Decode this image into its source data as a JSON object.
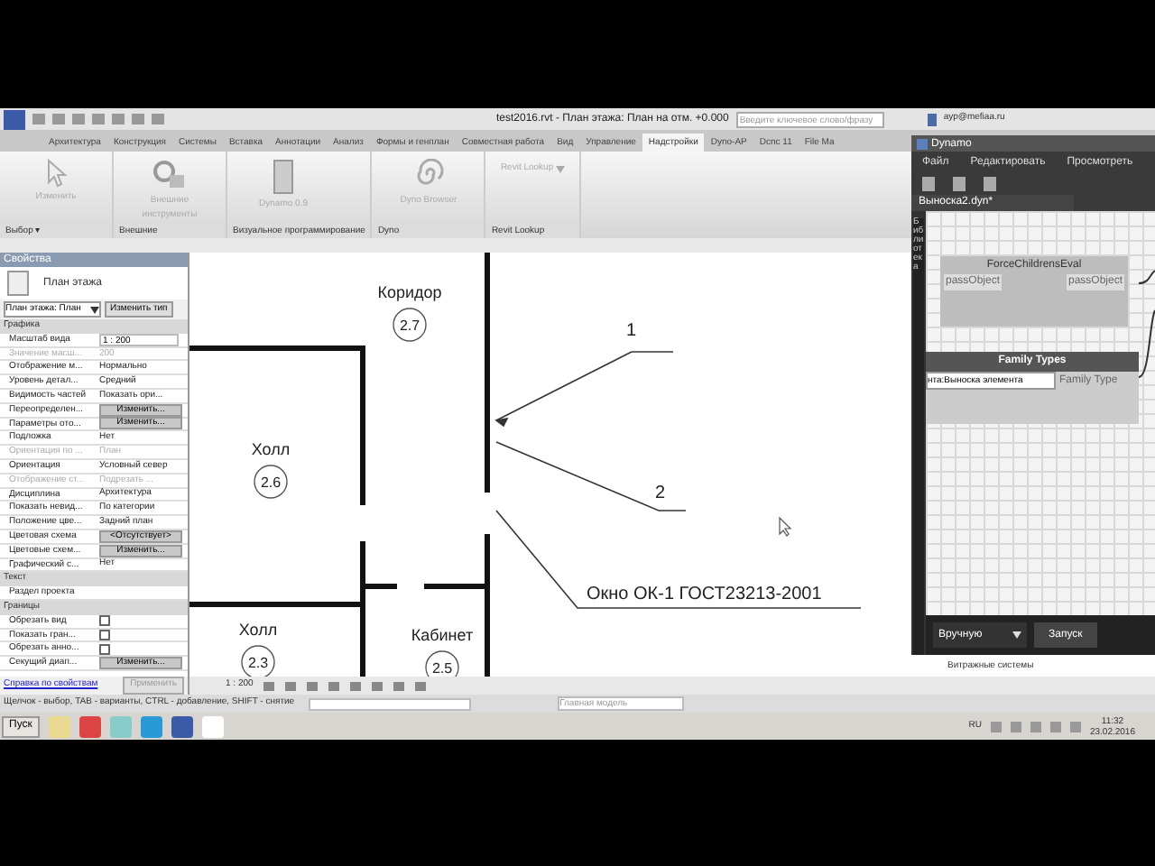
{
  "title_bar": {
    "title": "test2016.rvt - План этажа: План на отм. +0.000",
    "search": {
      "placeholder": "Введите ключевое слово/фразу"
    },
    "user": "ayp@mefiaa.ru"
  },
  "ribbon_tabs": [
    {
      "label": "Архитектура",
      "selected": false
    },
    {
      "label": "Конструкция",
      "selected": false
    },
    {
      "label": "Системы",
      "selected": false
    },
    {
      "label": "Вставка",
      "selected": false
    },
    {
      "label": "Аннотации",
      "selected": false
    },
    {
      "label": "Анализ",
      "selected": false
    },
    {
      "label": "Формы и генплан",
      "selected": false
    },
    {
      "label": "Совместная работа",
      "selected": false
    },
    {
      "label": "Вид",
      "selected": false
    },
    {
      "label": "Управление",
      "selected": false
    },
    {
      "label": "Надстройки",
      "selected": true
    },
    {
      "label": "Dyno-AP",
      "selected": false
    },
    {
      "label": "Dcnc 11",
      "selected": false
    },
    {
      "label": "File Ma",
      "selected": false
    }
  ],
  "ribbon_panels": [
    {
      "label": "Выбор ▾",
      "buttons": [
        {
          "label": "Изменить",
          "kind": "cursor"
        }
      ]
    },
    {
      "label": "Внешние",
      "buttons": [
        {
          "label": "Внешние инструменты",
          "kind": "tools"
        }
      ]
    },
    {
      "label": "Визуальное программирование",
      "buttons": [
        {
          "label": "Dynamo 0.9",
          "kind": "dynamo"
        }
      ]
    },
    {
      "label": "Dyno",
      "buttons": [
        {
          "label": "Dyno Browser",
          "kind": "spiral"
        }
      ]
    },
    {
      "label": "Revit Lookup",
      "buttons": [
        {
          "label": "Revit Lookup",
          "kind": "dropdown"
        }
      ]
    }
  ],
  "properties": {
    "title": "Свойства",
    "type_name": "План этажа",
    "type_select": "План этажа: План",
    "edit_type": "Изменить тип",
    "sections": [
      {
        "title": "Графика",
        "rows": [
          {
            "label": "Масштаб вида",
            "value": "1 : 200",
            "kind": "input",
            "disabled": false
          },
          {
            "label": "Значение масш...",
            "value": "200",
            "kind": "text",
            "disabled": true
          },
          {
            "label": "Отображение м...",
            "value": "Нормально",
            "kind": "text",
            "disabled": false
          },
          {
            "label": "Уровень детал...",
            "value": "Средний",
            "kind": "text",
            "disabled": false
          },
          {
            "label": "Видимость частей",
            "value": "Показать ори...",
            "kind": "text",
            "disabled": false
          },
          {
            "label": "Переопределен...",
            "value": "Изменить...",
            "kind": "button",
            "disabled": false
          },
          {
            "label": "Параметры ото...",
            "value": "Изменить...",
            "kind": "button",
            "disabled": false
          },
          {
            "label": "Подложка",
            "value": "Нет",
            "kind": "text",
            "disabled": false
          },
          {
            "label": "Ориентация по ...",
            "value": "План",
            "kind": "text",
            "disabled": true
          },
          {
            "label": "Ориентация",
            "value": "Условный север",
            "kind": "text",
            "disabled": false
          },
          {
            "label": "Отображение ст...",
            "value": "Подрезать ...",
            "kind": "text",
            "disabled": true
          },
          {
            "label": "Дисциплина",
            "value": "Архитектура",
            "kind": "text",
            "disabled": false
          },
          {
            "label": "Показать невид...",
            "value": "По категории",
            "kind": "text",
            "disabled": false
          },
          {
            "label": "Положение цве...",
            "value": "Задний план",
            "kind": "text",
            "disabled": false
          },
          {
            "label": "Цветовая схема",
            "value": "<Отсутствует>",
            "kind": "button",
            "disabled": false
          },
          {
            "label": "Цветовые схем...",
            "value": "Изменить...",
            "kind": "button",
            "disabled": false
          },
          {
            "label": "Графический с...",
            "value": "Нет",
            "kind": "text",
            "disabled": false
          }
        ]
      },
      {
        "title": "Текст",
        "rows": [
          {
            "label": "Раздел проекта",
            "kind": "text",
            "disabled": false
          }
        ]
      },
      {
        "title": "Границы",
        "rows": [
          {
            "label": "Обрезать вид",
            "kind": "check",
            "checked": false,
            "disabled": false
          },
          {
            "label": "Показать гран...",
            "kind": "check",
            "checked": false,
            "disabled": false
          },
          {
            "label": "Обрезать анно...",
            "kind": "check",
            "checked": false,
            "disabled": false
          },
          {
            "label": "Секущий диап...",
            "value": "Изменить...",
            "kind": "button",
            "disabled": false
          }
        ]
      }
    ],
    "help_link": "Справка по свойствам",
    "apply": "Применить"
  },
  "drawing": {
    "rooms": [
      {
        "name": "Коридор",
        "number": "2.7"
      },
      {
        "name": "Холл",
        "number": "2.6"
      },
      {
        "name": "Холл",
        "number": "2.3"
      },
      {
        "name": "Кабинет",
        "number": "2.5"
      }
    ],
    "leaders": [
      {
        "label": "1"
      },
      {
        "label": "2"
      },
      {
        "label": "Окно ОК-1 ГОСТ23213-2001"
      }
    ]
  },
  "view_bar": {
    "scale": "1 : 200"
  },
  "project_browser": {
    "item": "Витражные системы"
  },
  "dynamo": {
    "title": "Dynamo",
    "menu": [
      "Файл",
      "Редактировать",
      "Просмотреть"
    ],
    "tab": "Выноска2.dyn*",
    "library": "Библиотека",
    "nodes": [
      {
        "title": "ForceChildrensEval",
        "input": "passObject",
        "output": "passObject"
      },
      {
        "title": "Family Types",
        "dropdown": "нта:Выноска элемента",
        "output": "Family Type"
      }
    ],
    "run_mode": "Вручную",
    "run": "Запуск"
  },
  "status_bar": {
    "hint": "Щелчок - выбор, TAB - варианты, CTRL - добавление, SHIFT - снятие",
    "model": "Главная модель"
  },
  "taskbar": {
    "start": "Пуск",
    "lang": "RU",
    "time": "11:32",
    "date": "23.02.2016"
  }
}
